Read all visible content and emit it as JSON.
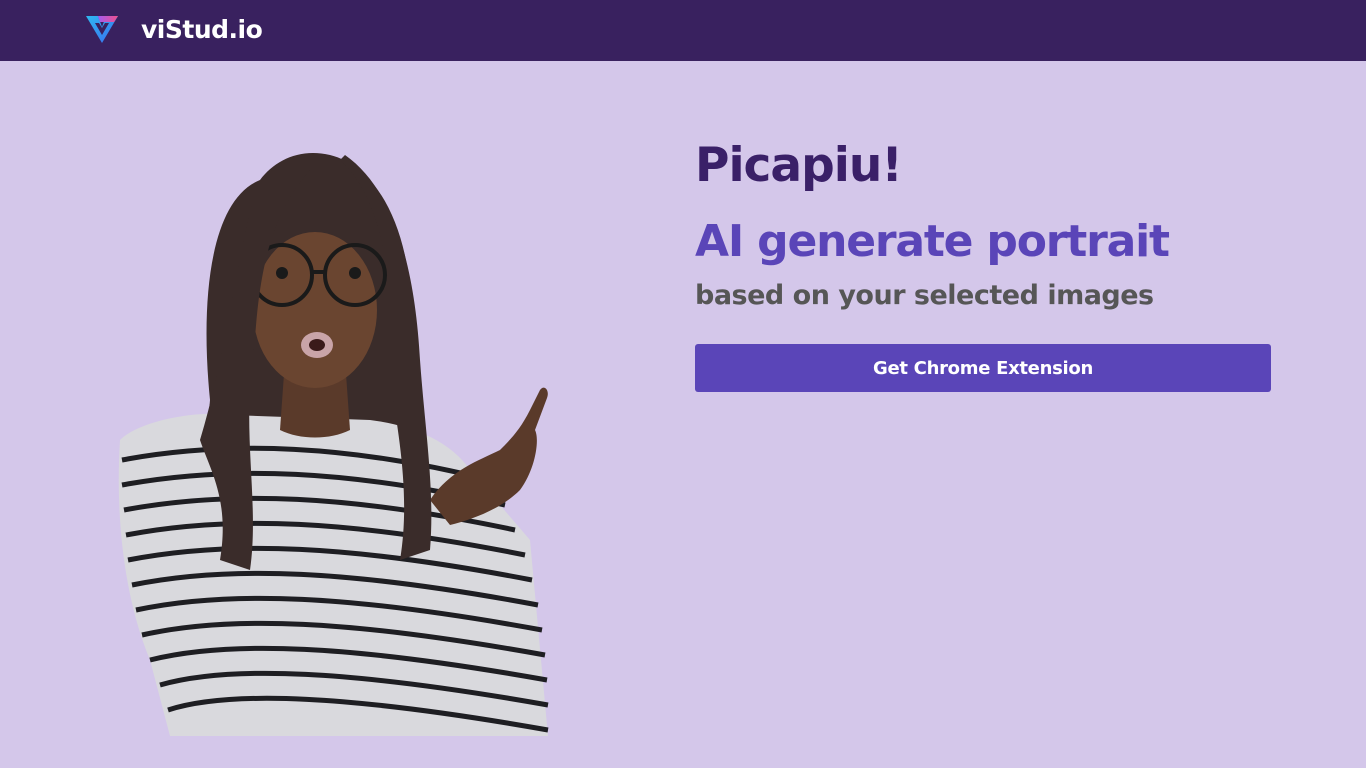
{
  "header": {
    "brand_name": "viStud.io",
    "logo_icon": "vistudio-logo-icon"
  },
  "hero": {
    "image_description": "surprised-woman-pointing-image",
    "product_name": "Picapiu!",
    "tagline": "AI generate portrait",
    "subtagline": "based on your selected images",
    "cta_label": "Get Chrome Extension"
  },
  "colors": {
    "header_bg": "#39215f",
    "page_bg": "#d4c7ea",
    "accent": "#5a45b8",
    "title": "#3a2068",
    "subtitle": "#565656"
  }
}
